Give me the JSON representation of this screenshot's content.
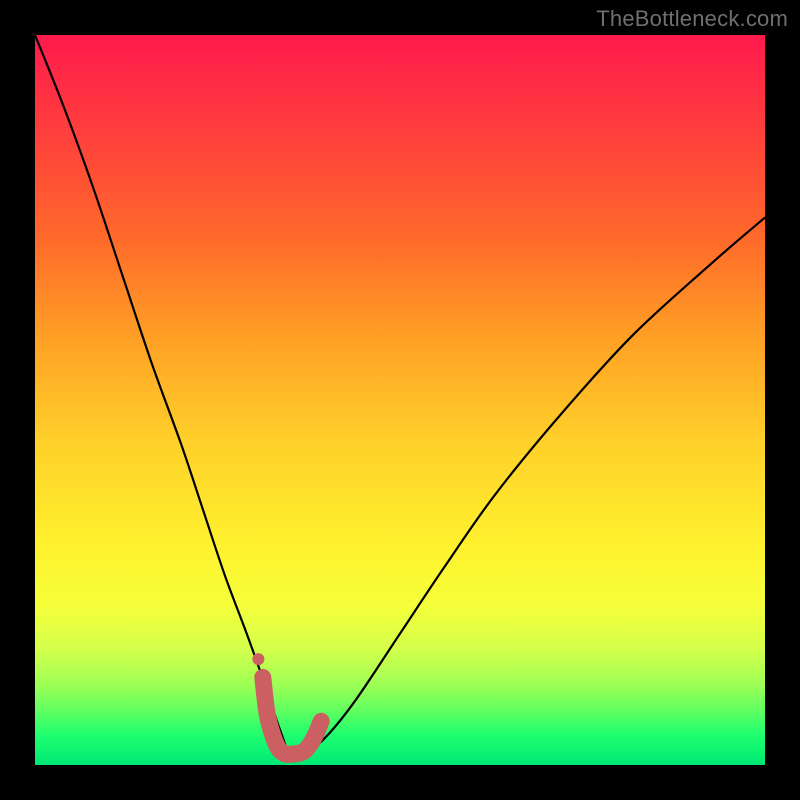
{
  "watermark": "TheBottleneck.com",
  "colors": {
    "page_bg": "#000000",
    "watermark": "#6f6f6f",
    "curve_stroke": "#000000",
    "marker_stroke": "#cb5f62",
    "marker_fill": "#cb5f62"
  },
  "chart_data": {
    "type": "line",
    "title": "",
    "xlabel": "",
    "ylabel": "",
    "xlim": [
      0,
      100
    ],
    "ylim": [
      0,
      100
    ],
    "grid": false,
    "legend": false,
    "note": "V-shaped bottleneck curve; colored background encodes severity (red=high bottleneck at top, green=low near bottom). The pink markers highlight the minimum region of the curve.",
    "series": [
      {
        "name": "bottleneck-curve",
        "x": [
          0,
          4,
          8,
          12,
          16,
          20,
          23,
          26,
          29,
          31.5,
          33.5,
          35,
          37,
          40,
          44,
          50,
          56,
          63,
          72,
          82,
          93,
          100
        ],
        "y": [
          100,
          90,
          79,
          67,
          55,
          44,
          35,
          26,
          18,
          11,
          5,
          1.5,
          1.5,
          4,
          9,
          18,
          27,
          37,
          48,
          59,
          69,
          75
        ]
      }
    ],
    "markers": {
      "name": "highlight-minimum",
      "x": [
        31.2,
        31.8,
        32.6,
        33.4,
        34.3,
        35.2,
        36.1,
        37.0,
        37.8,
        38.5,
        39.2
      ],
      "y": [
        12.0,
        7.0,
        4.0,
        2.2,
        1.5,
        1.5,
        1.6,
        2.0,
        3.0,
        4.3,
        6.0
      ],
      "lone_point": {
        "x": 30.6,
        "y": 14.5
      }
    }
  }
}
